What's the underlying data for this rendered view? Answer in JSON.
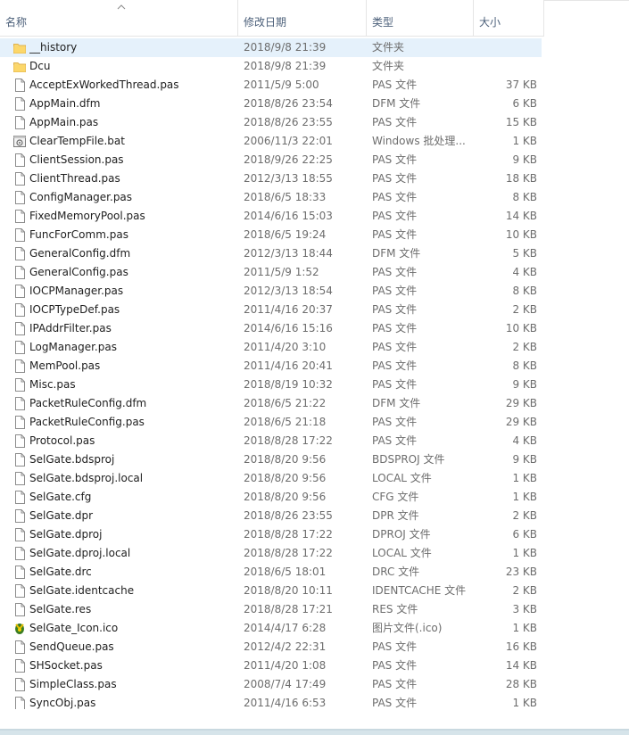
{
  "columns": {
    "name": "名称",
    "date": "修改日期",
    "type": "类型",
    "size": "大小"
  },
  "files": [
    {
      "name": "__history",
      "date": "2018/9/8 21:39",
      "type": "文件夹",
      "size": "",
      "icon": "folder-icon",
      "selected": true
    },
    {
      "name": "Dcu",
      "date": "2018/9/8 21:39",
      "type": "文件夹",
      "size": "",
      "icon": "folder-icon"
    },
    {
      "name": "AcceptExWorkedThread.pas",
      "date": "2011/5/9 5:00",
      "type": "PAS 文件",
      "size": "37 KB",
      "icon": "file-icon"
    },
    {
      "name": "AppMain.dfm",
      "date": "2018/8/26 23:54",
      "type": "DFM 文件",
      "size": "6 KB",
      "icon": "file-icon"
    },
    {
      "name": "AppMain.pas",
      "date": "2018/8/26 23:55",
      "type": "PAS 文件",
      "size": "15 KB",
      "icon": "file-icon"
    },
    {
      "name": "ClearTempFile.bat",
      "date": "2006/11/3 22:01",
      "type": "Windows 批处理...",
      "size": "1 KB",
      "icon": "batch-file-icon"
    },
    {
      "name": "ClientSession.pas",
      "date": "2018/9/26 22:25",
      "type": "PAS 文件",
      "size": "9 KB",
      "icon": "file-icon"
    },
    {
      "name": "ClientThread.pas",
      "date": "2012/3/13 18:55",
      "type": "PAS 文件",
      "size": "18 KB",
      "icon": "file-icon"
    },
    {
      "name": "ConfigManager.pas",
      "date": "2018/6/5 18:33",
      "type": "PAS 文件",
      "size": "8 KB",
      "icon": "file-icon"
    },
    {
      "name": "FixedMemoryPool.pas",
      "date": "2014/6/16 15:03",
      "type": "PAS 文件",
      "size": "14 KB",
      "icon": "file-icon"
    },
    {
      "name": "FuncForComm.pas",
      "date": "2018/6/5 19:24",
      "type": "PAS 文件",
      "size": "10 KB",
      "icon": "file-icon"
    },
    {
      "name": "GeneralConfig.dfm",
      "date": "2012/3/13 18:44",
      "type": "DFM 文件",
      "size": "5 KB",
      "icon": "file-icon"
    },
    {
      "name": "GeneralConfig.pas",
      "date": "2011/5/9 1:52",
      "type": "PAS 文件",
      "size": "4 KB",
      "icon": "file-icon"
    },
    {
      "name": "IOCPManager.pas",
      "date": "2012/3/13 18:54",
      "type": "PAS 文件",
      "size": "8 KB",
      "icon": "file-icon"
    },
    {
      "name": "IOCPTypeDef.pas",
      "date": "2011/4/16 20:37",
      "type": "PAS 文件",
      "size": "2 KB",
      "icon": "file-icon"
    },
    {
      "name": "IPAddrFilter.pas",
      "date": "2014/6/16 15:16",
      "type": "PAS 文件",
      "size": "10 KB",
      "icon": "file-icon"
    },
    {
      "name": "LogManager.pas",
      "date": "2011/4/20 3:10",
      "type": "PAS 文件",
      "size": "2 KB",
      "icon": "file-icon"
    },
    {
      "name": "MemPool.pas",
      "date": "2011/4/16 20:41",
      "type": "PAS 文件",
      "size": "8 KB",
      "icon": "file-icon"
    },
    {
      "name": "Misc.pas",
      "date": "2018/8/19 10:32",
      "type": "PAS 文件",
      "size": "9 KB",
      "icon": "file-icon"
    },
    {
      "name": "PacketRuleConfig.dfm",
      "date": "2018/6/5 21:22",
      "type": "DFM 文件",
      "size": "29 KB",
      "icon": "file-icon"
    },
    {
      "name": "PacketRuleConfig.pas",
      "date": "2018/6/5 21:18",
      "type": "PAS 文件",
      "size": "29 KB",
      "icon": "file-icon"
    },
    {
      "name": "Protocol.pas",
      "date": "2018/8/28 17:22",
      "type": "PAS 文件",
      "size": "4 KB",
      "icon": "file-icon"
    },
    {
      "name": "SelGate.bdsproj",
      "date": "2018/8/20 9:56",
      "type": "BDSPROJ 文件",
      "size": "9 KB",
      "icon": "file-icon"
    },
    {
      "name": "SelGate.bdsproj.local",
      "date": "2018/8/20 9:56",
      "type": "LOCAL 文件",
      "size": "1 KB",
      "icon": "file-icon"
    },
    {
      "name": "SelGate.cfg",
      "date": "2018/8/20 9:56",
      "type": "CFG 文件",
      "size": "1 KB",
      "icon": "file-icon"
    },
    {
      "name": "SelGate.dpr",
      "date": "2018/8/26 23:55",
      "type": "DPR 文件",
      "size": "2 KB",
      "icon": "file-icon"
    },
    {
      "name": "SelGate.dproj",
      "date": "2018/8/28 17:22",
      "type": "DPROJ 文件",
      "size": "6 KB",
      "icon": "file-icon"
    },
    {
      "name": "SelGate.dproj.local",
      "date": "2018/8/28 17:22",
      "type": "LOCAL 文件",
      "size": "1 KB",
      "icon": "file-icon"
    },
    {
      "name": "SelGate.drc",
      "date": "2018/6/5 18:01",
      "type": "DRC 文件",
      "size": "23 KB",
      "icon": "file-icon"
    },
    {
      "name": "SelGate.identcache",
      "date": "2018/8/20 10:11",
      "type": "IDENTCACHE 文件",
      "size": "2 KB",
      "icon": "file-icon"
    },
    {
      "name": "SelGate.res",
      "date": "2018/8/28 17:21",
      "type": "RES 文件",
      "size": "3 KB",
      "icon": "file-icon"
    },
    {
      "name": "SelGate_Icon.ico",
      "date": "2014/4/17 6:28",
      "type": "图片文件(.ico)",
      "size": "1 KB",
      "icon": "ico-image-icon"
    },
    {
      "name": "SendQueue.pas",
      "date": "2012/4/2 22:31",
      "type": "PAS 文件",
      "size": "16 KB",
      "icon": "file-icon"
    },
    {
      "name": "SHSocket.pas",
      "date": "2011/4/20 1:08",
      "type": "PAS 文件",
      "size": "14 KB",
      "icon": "file-icon"
    },
    {
      "name": "SimpleClass.pas",
      "date": "2008/7/4 17:49",
      "type": "PAS 文件",
      "size": "28 KB",
      "icon": "file-icon"
    },
    {
      "name": "SyncObj.pas",
      "date": "2011/4/16 6:53",
      "type": "PAS 文件",
      "size": "1 KB",
      "icon": "file-icon"
    }
  ]
}
